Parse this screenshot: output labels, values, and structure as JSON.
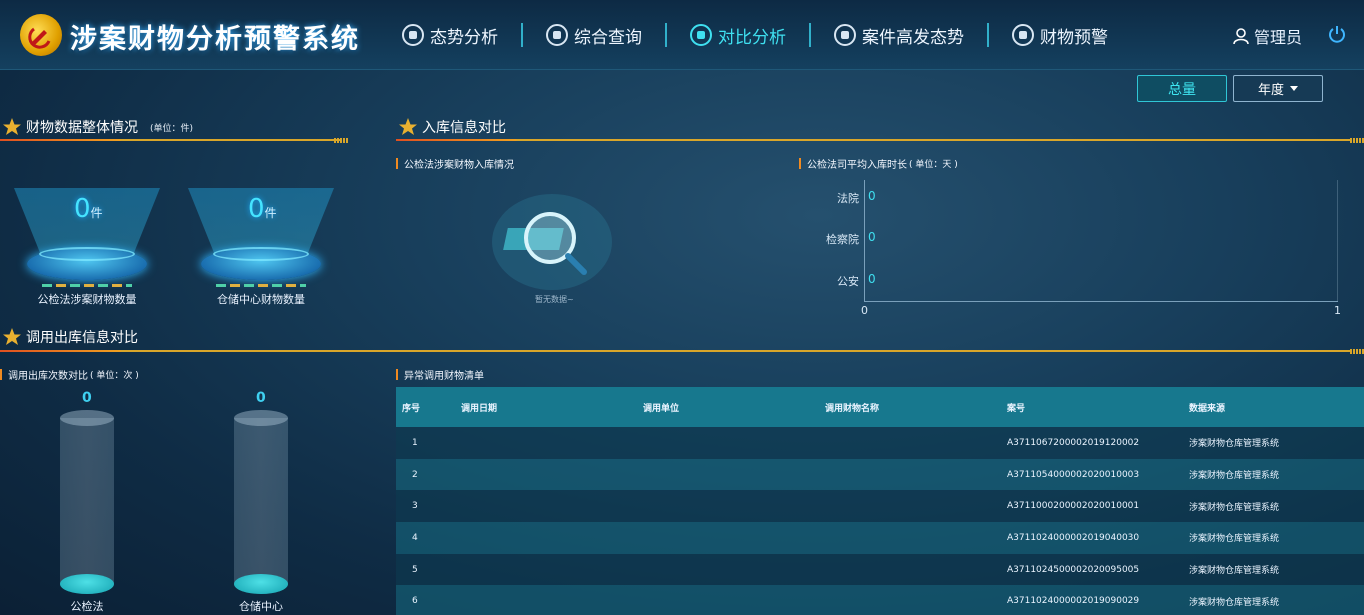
{
  "header": {
    "title": "涉案财物分析预警系统",
    "nav": [
      {
        "label": "态势分析",
        "icon": "speedometer-icon"
      },
      {
        "label": "综合查询",
        "icon": "search-target-icon"
      },
      {
        "label": "对比分析",
        "icon": "compare-icon",
        "active": true
      },
      {
        "label": "案件高发态势",
        "icon": "chart-trend-icon"
      },
      {
        "label": "财物预警",
        "icon": "alarm-icon"
      }
    ],
    "user": "管理员"
  },
  "filters": {
    "total_label": "总量",
    "year_label": "年度"
  },
  "overview": {
    "title": "财物数据整体情况",
    "unit": "(单位：件)",
    "cards": [
      {
        "value": "0",
        "unit": "件",
        "label": "公检法涉案财物数量"
      },
      {
        "value": "0",
        "unit": "件",
        "label": "仓储中心财物数量"
      }
    ]
  },
  "storage": {
    "title": "入库信息对比",
    "left_sub": "公检法涉案财物入库情况",
    "empty_text": "暂无数据~",
    "right_sub": "公检法司平均入库时长",
    "right_unit": "( 单位：天 )",
    "bars": [
      {
        "label": "法院",
        "value": "0"
      },
      {
        "label": "检察院",
        "value": "0"
      },
      {
        "label": "公安",
        "value": "0"
      }
    ],
    "x_ticks": [
      "0",
      "1"
    ]
  },
  "outbound": {
    "title": "调用出库信息对比",
    "sub": "调用出库次数对比",
    "unit": "( 单位：次 )",
    "cylinders": [
      {
        "label": "公检法",
        "value": "0"
      },
      {
        "label": "仓储中心",
        "value": "0"
      }
    ]
  },
  "anomaly": {
    "title": "异常调用财物清单",
    "columns": [
      "序号",
      "调用日期",
      "调用单位",
      "调用财物名称",
      "案号",
      "数据来源"
    ],
    "rows": [
      {
        "no": "1",
        "date": "",
        "unit": "",
        "name": "",
        "case": "A3711067200002019120002",
        "source": "涉案财物仓库管理系统"
      },
      {
        "no": "2",
        "date": "",
        "unit": "",
        "name": "",
        "case": "A3711054000002020010003",
        "source": "涉案财物仓库管理系统"
      },
      {
        "no": "3",
        "date": "",
        "unit": "",
        "name": "",
        "case": "A3711000200002020010001",
        "source": "涉案财物仓库管理系统"
      },
      {
        "no": "4",
        "date": "",
        "unit": "",
        "name": "",
        "case": "A3711024000002019040030",
        "source": "涉案财物仓库管理系统"
      },
      {
        "no": "5",
        "date": "",
        "unit": "",
        "name": "",
        "case": "A3711024500002020095005",
        "source": "涉案财物仓库管理系统"
      },
      {
        "no": "6",
        "date": "",
        "unit": "",
        "name": "",
        "case": "A3711024000002019090029",
        "source": "涉案财物仓库管理系统"
      }
    ]
  }
}
